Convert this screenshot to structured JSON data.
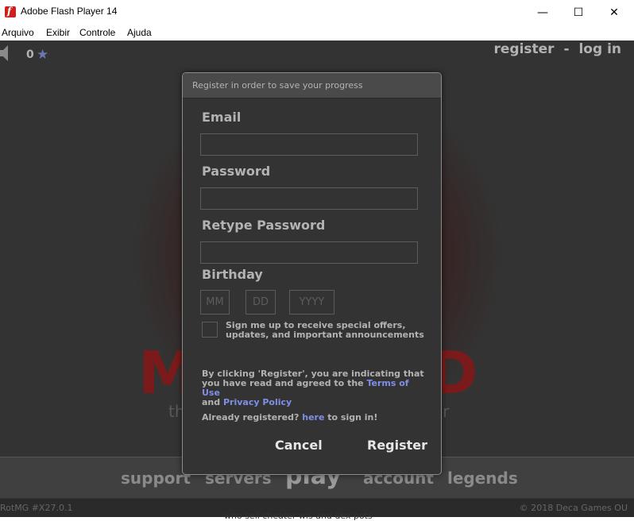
{
  "window": {
    "title": "Adobe Flash Player 14",
    "minimize": "—",
    "maximize": "☐",
    "close": "✕"
  },
  "menu": {
    "items": [
      "Arquivo",
      "Exibir",
      "Controle",
      "Ajuda"
    ]
  },
  "game": {
    "star_count": "0",
    "star_color": "#6c77b3",
    "top_links": {
      "register": "register",
      "separator": "-",
      "login": "log in"
    },
    "logo_left": "M",
    "logo_right": "D",
    "logo_sub_left": "th",
    "logo_sub_right": "er",
    "nav": {
      "support": "support",
      "servers": "servers",
      "play": "play",
      "account": "account",
      "legends": "legends"
    },
    "version": "RotMG #X27.0.1",
    "copyright": "© 2018 Deca Games OU",
    "below_text": "who sell cheater wis and dex pots"
  },
  "modal": {
    "title": "Register in order to save your progress",
    "email_label": "Email",
    "email_value": "",
    "password_label": "Password",
    "password_value": "",
    "retype_label": "Retype Password",
    "retype_value": "",
    "birthday_label": "Birthday",
    "birthday_placeholders": {
      "month": "MM",
      "day": "DD",
      "year": "YYYY"
    },
    "offers_label": "Sign me up to receive special offers, updates, and important announcements",
    "legal_prefix": "By clicking 'Register', you are indicating that you have read and agreed to the ",
    "terms_link": "Terms of Use",
    "legal_and": " and ",
    "privacy_link": "Privacy Policy",
    "already_prefix": "Already registered? ",
    "here_link": "here",
    "already_suffix": " to sign in!",
    "cancel": "Cancel",
    "register": "Register",
    "link_color": "#7f8fe6"
  }
}
